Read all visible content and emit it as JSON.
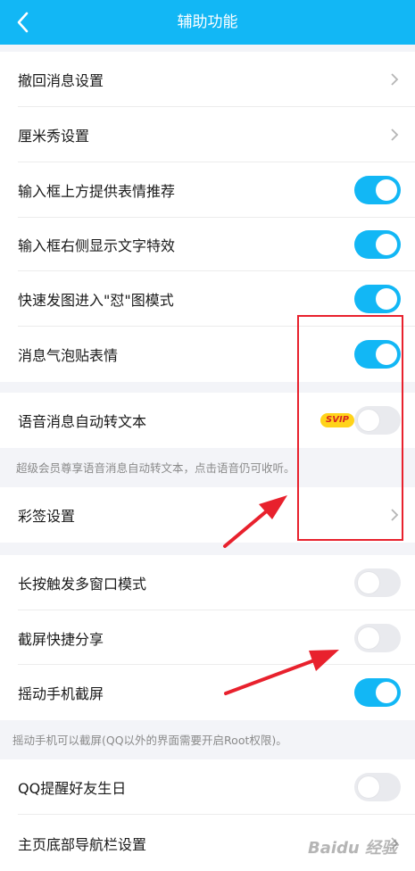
{
  "header": {
    "title": "辅助功能"
  },
  "rows": [
    {
      "label": "撤回消息设置",
      "control": "chevron"
    },
    {
      "label": "厘米秀设置",
      "control": "chevron"
    },
    {
      "label": "输入框上方提供表情推荐",
      "control": "toggle",
      "state": "on"
    },
    {
      "label": "输入框右侧显示文字特效",
      "control": "toggle",
      "state": "on"
    },
    {
      "label": "快速发图进入\"怼\"图模式",
      "control": "toggle",
      "state": "on"
    },
    {
      "label": "消息气泡贴表情",
      "control": "toggle",
      "state": "on"
    },
    {
      "label": "语音消息自动转文本",
      "control": "toggle",
      "state": "off",
      "badge": "SVIP"
    },
    {
      "label": "彩签设置",
      "control": "chevron"
    },
    {
      "label": "长按触发多窗口模式",
      "control": "toggle",
      "state": "off"
    },
    {
      "label": "截屏快捷分享",
      "control": "toggle",
      "state": "off"
    },
    {
      "label": "摇动手机截屏",
      "control": "toggle",
      "state": "on"
    },
    {
      "label": "QQ提醒好友生日",
      "control": "toggle",
      "state": "off"
    },
    {
      "label": "主页底部导航栏设置",
      "control": "chevron"
    }
  ],
  "notes": {
    "voice": "超级会员尊享语音消息自动转文本，点击语音仍可收听。",
    "shake": "摇动手机可以截屏(QQ以外的界面需要开启Root权限)。"
  },
  "watermark": "Baidu 经验",
  "colors": {
    "accent": "#12b7f5",
    "annotation": "#e8212d"
  }
}
